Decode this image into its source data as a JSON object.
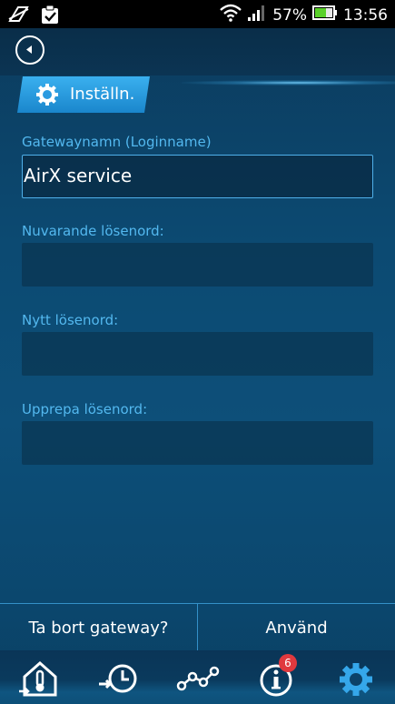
{
  "status_bar": {
    "battery": "57%",
    "time": "13:56"
  },
  "section": {
    "title": "Inställn."
  },
  "form": {
    "gateway_name_label": "Gatewaynamn (Loginname)",
    "gateway_name_value": "AirX service",
    "current_password_label": "Nuvarande lösenord:",
    "current_password_value": "",
    "new_password_label": "Nytt lösenord:",
    "new_password_value": "",
    "repeat_password_label": "Upprepa lösenord:",
    "repeat_password_value": ""
  },
  "actions": {
    "remove_gateway": "Ta bort gateway?",
    "apply": "Använd"
  },
  "nav": {
    "items": [
      {
        "icon": "home-temperature-icon"
      },
      {
        "icon": "history-clock-icon"
      },
      {
        "icon": "graph-icon"
      },
      {
        "icon": "info-icon",
        "badge": "6"
      },
      {
        "icon": "settings-gear-icon"
      }
    ]
  },
  "colors": {
    "accent": "#3ab0ef",
    "label": "#53b8ef",
    "badge": "#e0393e",
    "battery": "#5ad12a"
  }
}
